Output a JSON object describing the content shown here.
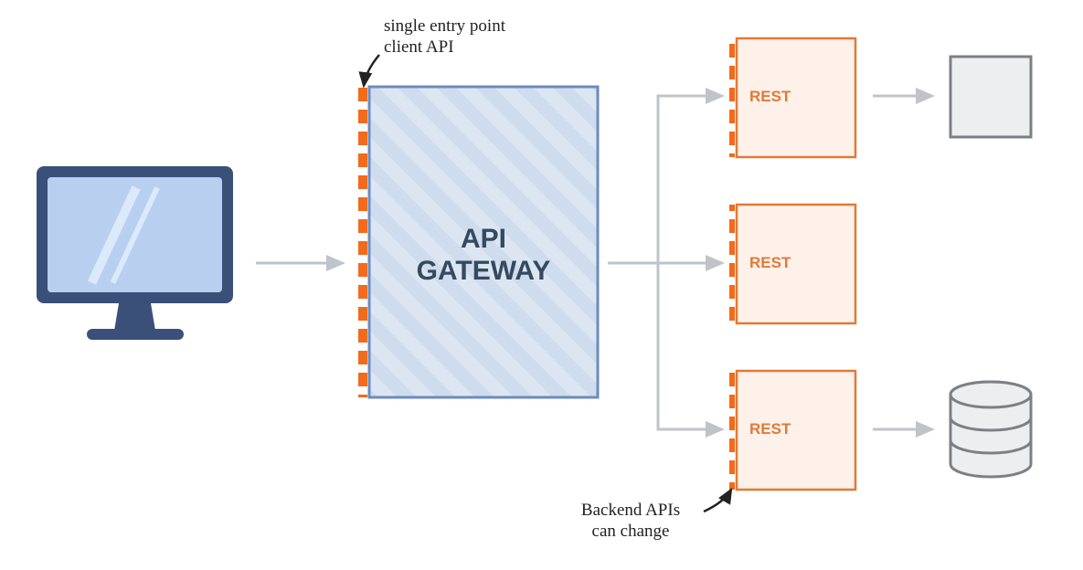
{
  "annotations": {
    "entry_point": "single entry point\nclient API",
    "backend_change": "Backend APIs\ncan change"
  },
  "gateway": {
    "title_line1": "API",
    "title_line2": "GATEWAY"
  },
  "services": {
    "s1_label": "REST",
    "s2_label": "REST",
    "s3_label": "REST"
  },
  "colors": {
    "client_stroke": "#3a5079",
    "client_fill": "#b8cff0",
    "gateway_stroke": "#6d8bbd",
    "gateway_fill": "#dce6f2",
    "gateway_stripe": "#cad9ec",
    "accent_orange": "#f26a1b",
    "service_stroke": "#e07a36",
    "service_fill": "#fdf1ea",
    "service_dash": "#f26a1b",
    "arrow": "#bfc4c9",
    "grey_box_stroke": "#7c8084",
    "grey_box_fill": "#eceeef",
    "db_stroke": "#7c8084",
    "db_fill": "#eceeef"
  }
}
